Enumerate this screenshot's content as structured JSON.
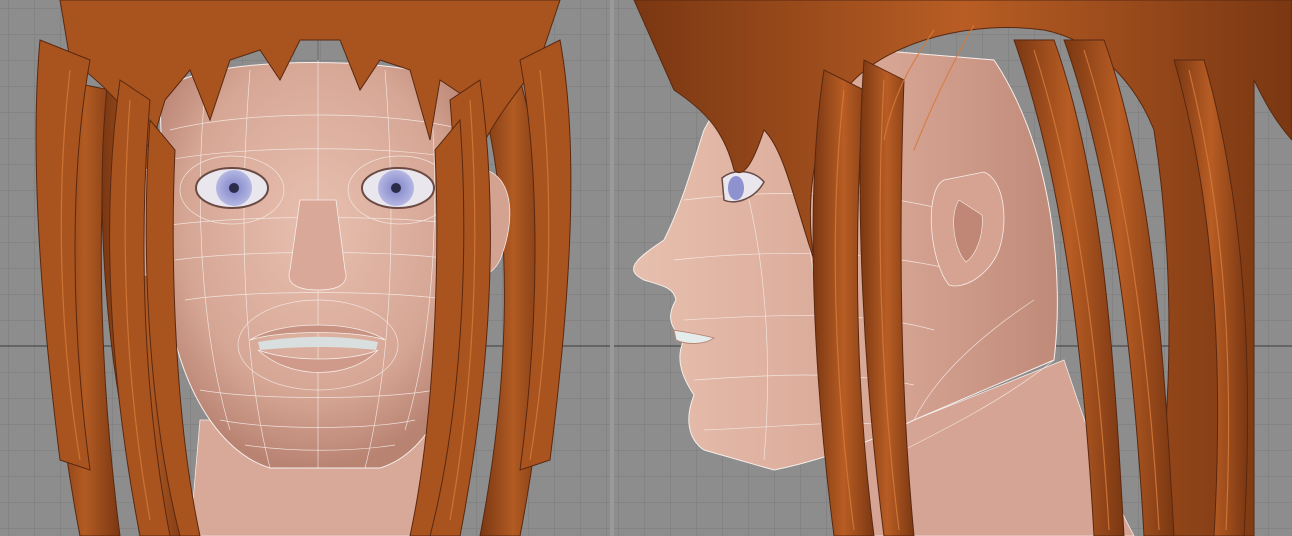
{
  "viewports": [
    {
      "view": "front",
      "grid": true
    },
    {
      "view": "side",
      "grid": true
    }
  ],
  "colors": {
    "background": "#8d8d8d",
    "grid_line": "#7b7b7b",
    "axis_line": "#3a3a3a",
    "skin": "#ddb0a0",
    "skin_shadow": "#c48d7d",
    "wire": "#f6eeea",
    "hair": "#a9541f",
    "hair_dark": "#6e3112",
    "hair_light": "#c76d30",
    "iris": "#8e92cf",
    "sclera": "#e9e6ee"
  }
}
